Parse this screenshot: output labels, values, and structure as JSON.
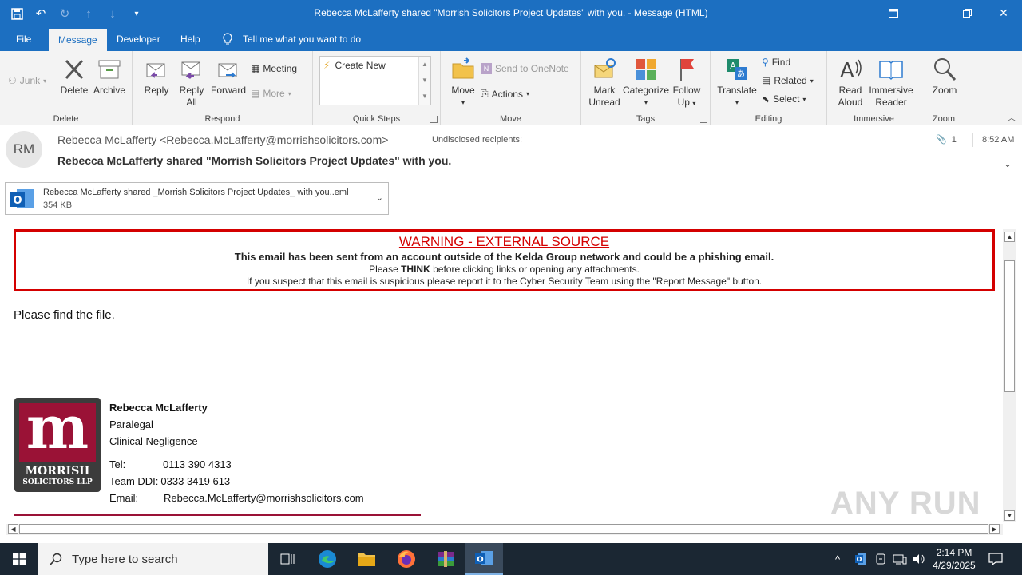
{
  "window": {
    "title": "Rebecca McLafferty shared \"Morrish Solicitors Project Updates\" with you.  -  Message (HTML)"
  },
  "tabs": [
    {
      "label": "File"
    },
    {
      "label": "Message"
    },
    {
      "label": "Developer"
    },
    {
      "label": "Help"
    }
  ],
  "tellme": {
    "label": "Tell me what you want to do"
  },
  "ribbon": {
    "delete_group": {
      "label": "Delete",
      "junk": "Junk",
      "delete": "Delete",
      "archive": "Archive"
    },
    "respond_group": {
      "label": "Respond",
      "reply": "Reply",
      "reply_all_1": "Reply",
      "reply_all_2": "All",
      "forward": "Forward",
      "meeting": "Meeting",
      "more": "More"
    },
    "quick_steps": {
      "label": "Quick Steps",
      "create_new": "Create New"
    },
    "move_group": {
      "label": "Move",
      "move": "Move",
      "onenote": "Send to OneNote",
      "actions": "Actions"
    },
    "tags_group": {
      "label": "Tags",
      "mark_unread_1": "Mark",
      "mark_unread_2": "Unread",
      "categorize": "Categorize",
      "follow_up_1": "Follow",
      "follow_up_2": "Up"
    },
    "editing_group": {
      "label": "Editing",
      "translate": "Translate",
      "find": "Find",
      "related": "Related",
      "select": "Select"
    },
    "immersive_group": {
      "label": "Immersive",
      "read_aloud_1": "Read",
      "read_aloud_2": "Aloud",
      "immersive_reader_1": "Immersive",
      "immersive_reader_2": "Reader"
    },
    "zoom_group": {
      "label": "Zoom",
      "zoom": "Zoom"
    }
  },
  "message": {
    "avatar_initials": "RM",
    "from": "Rebecca McLafferty <Rebecca.McLafferty@morrishsolicitors.com>",
    "to": "Undisclosed recipients:",
    "subject": "Rebecca McLafferty shared \"Morrish Solicitors Project Updates\" with you.",
    "attachment_count": "1",
    "time": "8:52 AM"
  },
  "attachment": {
    "name": "Rebecca McLafferty shared _Morrish Solicitors Project Updates_ with you..eml",
    "size": "354 KB"
  },
  "warning": {
    "title": "WARNING - EXTERNAL SOURCE",
    "line1": "This email has been sent from an account outside of the Kelda Group network and could be a phishing email.",
    "line2_pre": "Please ",
    "line2_bold": "THINK",
    "line2_post": " before clicking links or opening any attachments.",
    "line3": "If you suspect that this email is suspicious please report it to the Cyber Security Team using the \"Report Message\" button."
  },
  "body": {
    "text": "Please find the file."
  },
  "logo": {
    "letter": "m",
    "line1": "MORRISH",
    "line2": "SOLICITORS LLP"
  },
  "signature": {
    "name": "Rebecca McLafferty",
    "role": "Paralegal",
    "dept": "Clinical Negligence",
    "tel_label": "Tel:",
    "tel": "0113 390 4313",
    "ddi_label": "Team DDI:",
    "ddi": "0333 3419 613",
    "email_label": "Email:",
    "email": "Rebecca.McLafferty@morrishsolicitors.com"
  },
  "watermark": "ANY RUN",
  "taskbar": {
    "search_placeholder": "Type here to search",
    "time": "2:14 PM",
    "date": "4/29/2025"
  },
  "colors": {
    "accent": "#1c6fc1",
    "warning": "#d40000",
    "brand": "#9a1236"
  }
}
